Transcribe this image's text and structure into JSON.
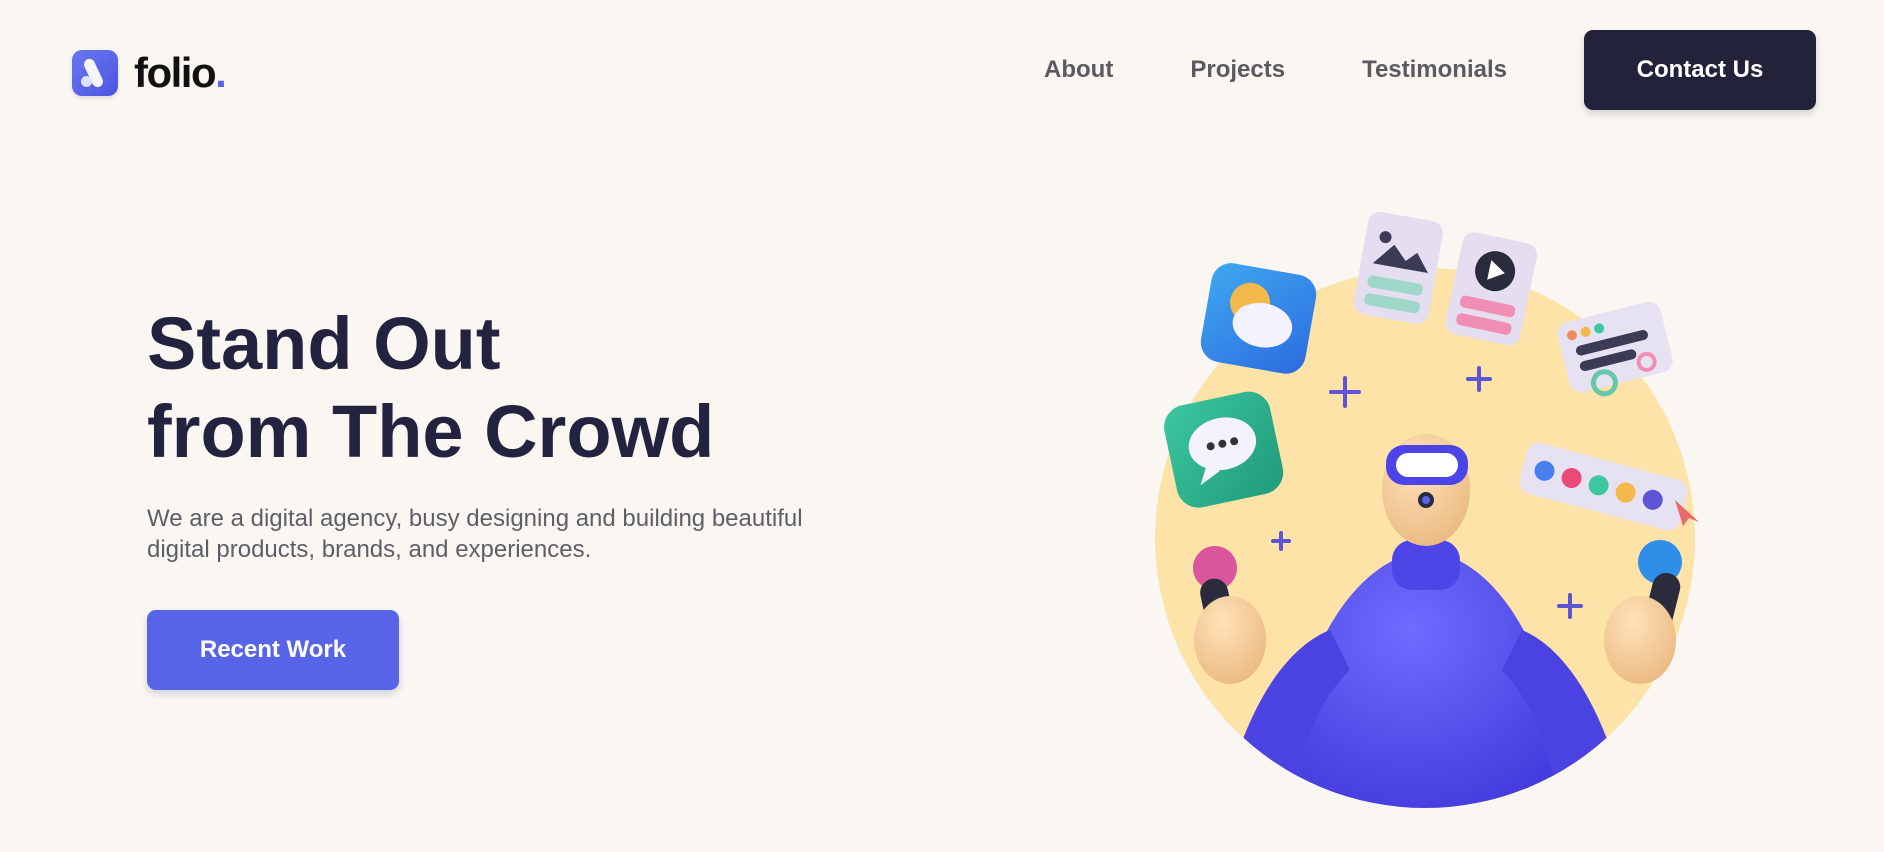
{
  "brand": {
    "name": "foli",
    "accent_char": "o",
    "dot": ".",
    "icon": "folio-logo-icon"
  },
  "nav": {
    "links": [
      "About",
      "Projects",
      "Testimonials"
    ],
    "contact_label": "Contact Us"
  },
  "hero": {
    "title_line1": "Stand Out",
    "title_line2": "from The Crowd",
    "subtitle_line1": "We are a digital agency, busy designing and building beautiful",
    "subtitle_line2": "digital products, brands, and experiences.",
    "cta_label": "Recent Work"
  },
  "colors": {
    "background": "#faf7f3",
    "dark": "#22223a",
    "accent": "#5864e8",
    "circle": "#fde3a8"
  }
}
